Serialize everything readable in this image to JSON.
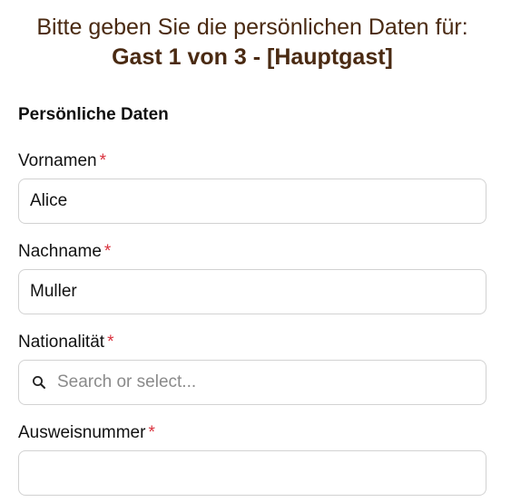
{
  "heading": {
    "line1": "Bitte geben Sie die persönlichen Daten für:",
    "line2": "Gast 1 von 3 - [Hauptgast]"
  },
  "section": {
    "title": "Persönliche Daten"
  },
  "fields": {
    "first_name": {
      "label": "Vornamen",
      "required_mark": "*",
      "value": "Alice"
    },
    "last_name": {
      "label": "Nachname",
      "required_mark": "*",
      "value": "Muller"
    },
    "nationality": {
      "label": "Nationalität",
      "required_mark": "*",
      "placeholder": "Search or select...",
      "icon": "search-icon"
    },
    "id_number": {
      "label": "Ausweisnummer",
      "required_mark": "*",
      "value": ""
    }
  },
  "colors": {
    "heading": "#4a2a12",
    "required": "#d9313d",
    "border": "#d2d2d2",
    "placeholder": "#8a8a8a"
  }
}
